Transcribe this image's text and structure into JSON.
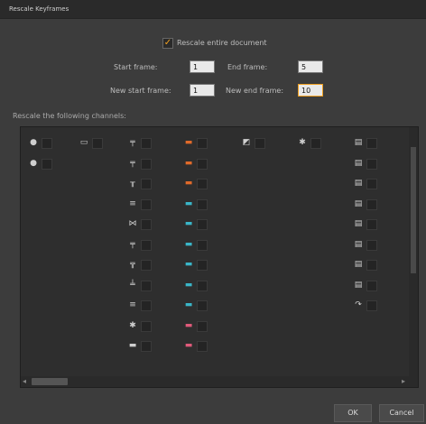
{
  "dialog": {
    "title": "Rescale Keyframes",
    "rescale_entire": "Rescale entire document",
    "rescale_entire_checked": true,
    "start_frame_label": "Start frame:",
    "start_frame_value": "1",
    "end_frame_label": "End frame:",
    "end_frame_value": "5",
    "new_start_label": "New start frame:",
    "new_start_value": "1",
    "new_end_label": "New end frame:",
    "new_end_value": "10",
    "channels_label": "Rescale the following channels:",
    "ok_label": "OK",
    "cancel_label": "Cancel"
  },
  "channels": {
    "columns": [
      {
        "icon": "object-icon",
        "color": "#cfcfcf",
        "glyphs": [
          "●",
          "●"
        ]
      },
      {
        "icon": "folder-icon",
        "color": "#cfcfcf",
        "glyphs": [
          "▭"
        ]
      },
      {
        "icon": "bone-icon",
        "color": "#cfcfcf",
        "glyphs": [
          "╤",
          "╤",
          "╥",
          "≡",
          "⋈",
          "╤",
          "╦",
          "╧",
          "≡",
          "✱",
          "▬"
        ]
      },
      {
        "icon": "bow-icon",
        "color": "#e06a2a",
        "glyphs": [
          "▬",
          "▬",
          "▬",
          "▬",
          "▬",
          "▬",
          "▬",
          "▬",
          "▬",
          "▬",
          "▬"
        ]
      },
      {
        "icon": "image-icon",
        "color": "#cfcfcf",
        "glyphs": [
          "◩"
        ]
      },
      {
        "icon": "gear-icon",
        "color": "#cfcfcf",
        "glyphs": [
          "✱"
        ]
      },
      {
        "icon": "document-icon",
        "color": "#cfcfcf",
        "glyphs": [
          "▤",
          "▤",
          "▤",
          "▤",
          "▤",
          "▤",
          "▤",
          "▤",
          "↷"
        ]
      },
      {
        "icon": "pin-icon",
        "color": "#cfcfcf",
        "glyphs": [
          "╡",
          "╡",
          "╡"
        ]
      }
    ]
  }
}
